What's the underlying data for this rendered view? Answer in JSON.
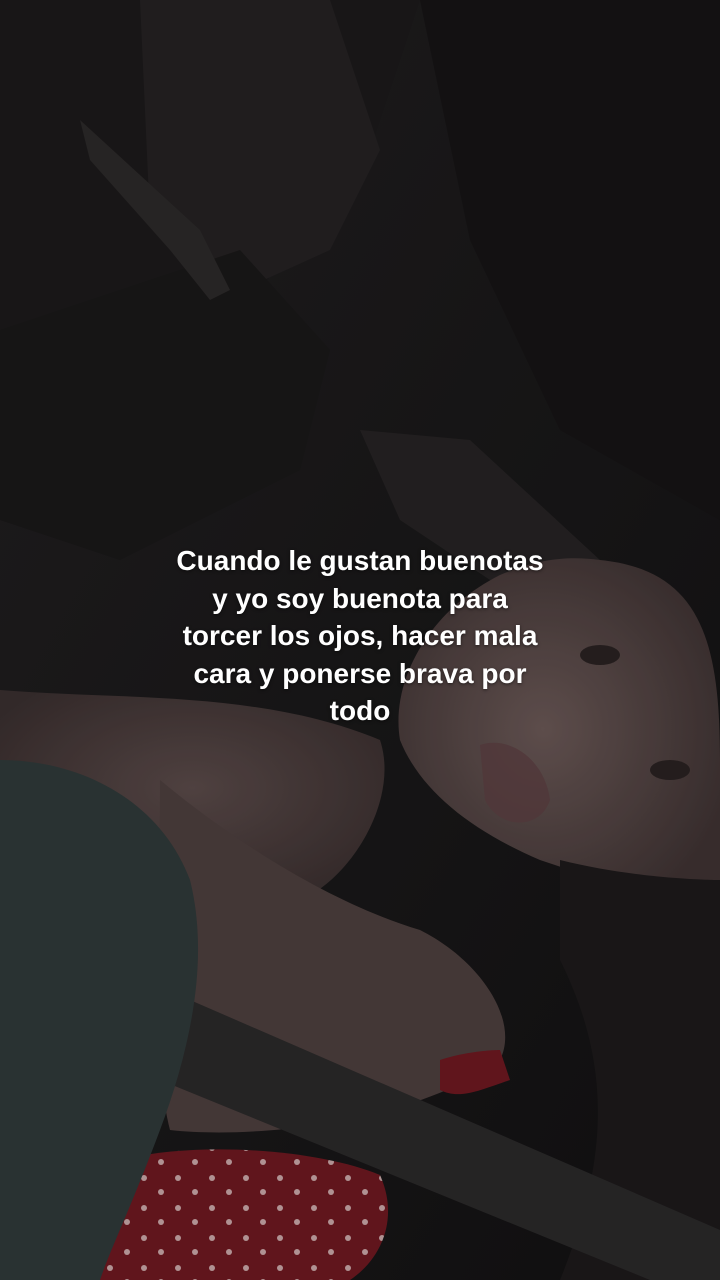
{
  "caption": {
    "lines": [
      "Cuando le gustan buenotas",
      "y yo soy buenota para",
      "torcer los ojos, hacer mala",
      "cara y ponerse brava por",
      "todo"
    ]
  },
  "colors": {
    "caption_text": "#ffffff",
    "background": "#181617",
    "dress_red": "#7a1a22"
  }
}
